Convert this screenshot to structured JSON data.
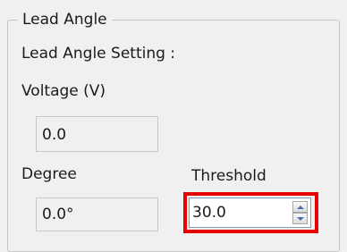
{
  "group": {
    "title": "Lead Angle",
    "setting_label": "Lead Angle Setting :"
  },
  "voltage": {
    "label": "Voltage (V)",
    "value": "0.0"
  },
  "degree": {
    "label": "Degree",
    "value": "0.0°"
  },
  "threshold": {
    "label": "Threshold",
    "value": "30.0"
  },
  "colors": {
    "highlight": "#e60000",
    "background": "#f0f0f0"
  }
}
